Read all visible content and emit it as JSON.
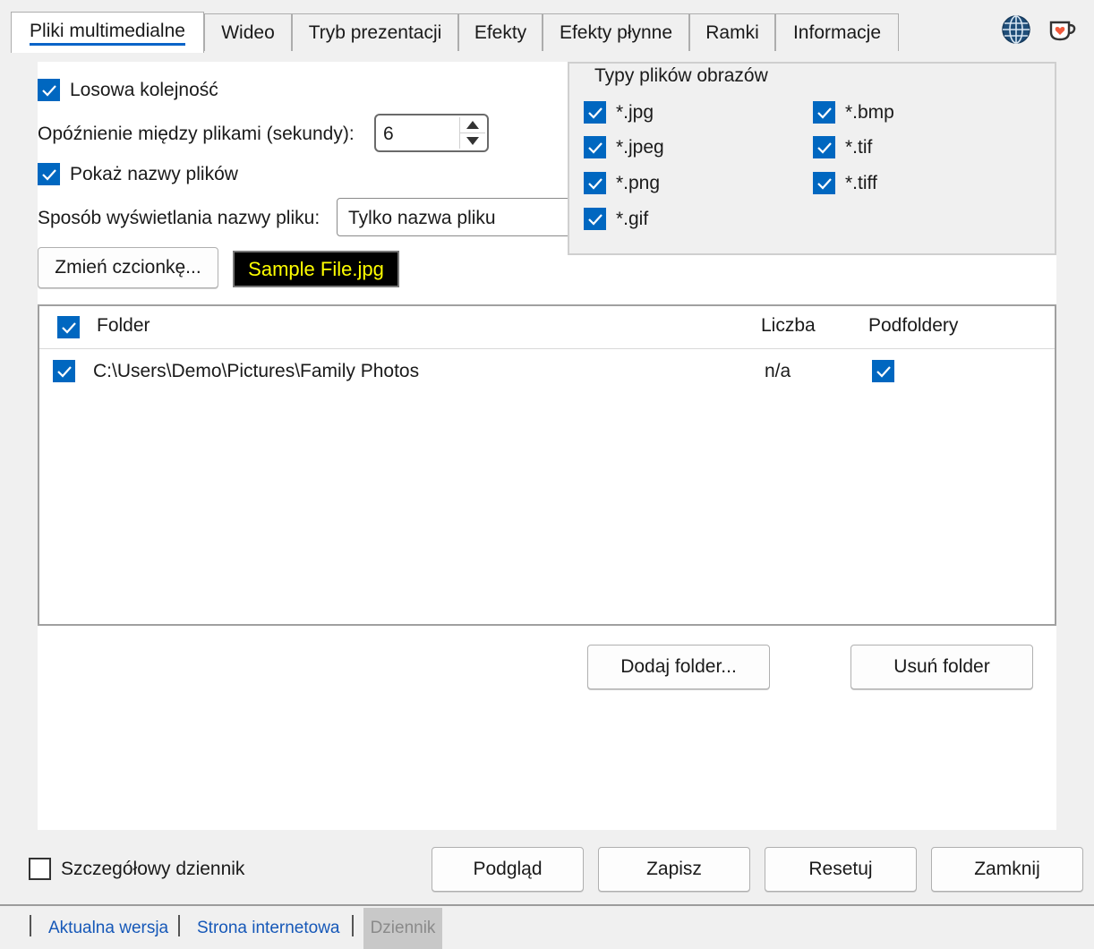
{
  "tabs": [
    {
      "label": "Pliki multimedialne",
      "active": true
    },
    {
      "label": "Wideo"
    },
    {
      "label": "Tryb prezentacji"
    },
    {
      "label": "Efekty"
    },
    {
      "label": "Efekty płynne"
    },
    {
      "label": "Ramki"
    },
    {
      "label": "Informacje"
    }
  ],
  "icons": {
    "language": "globe-icon",
    "donate": "coffee-heart-icon"
  },
  "settings": {
    "random_order_label": "Losowa kolejność",
    "random_order_checked": true,
    "delay_label": "Opóźnienie między plikami (sekundy):",
    "delay_value": "6",
    "show_names_label": "Pokaż nazwy plików",
    "show_names_checked": true,
    "name_display_label": "Sposób wyświetlania nazwy pliku:",
    "name_display_value": "Tylko nazwa pliku",
    "change_font_button": "Zmień czcionkę...",
    "font_sample": "Sample File.jpg",
    "font_sample_color": "#ffff00",
    "font_sample_bg": "#000000"
  },
  "image_types": {
    "title": "Typy plików obrazów",
    "items": [
      {
        "label": "*.jpg",
        "checked": true
      },
      {
        "label": "*.bmp",
        "checked": true
      },
      {
        "label": "*.jpeg",
        "checked": true
      },
      {
        "label": "*.tif",
        "checked": true
      },
      {
        "label": "*.png",
        "checked": true
      },
      {
        "label": "*.tiff",
        "checked": true
      },
      {
        "label": "*.gif",
        "checked": true
      }
    ]
  },
  "folders": {
    "columns": {
      "folder": "Folder",
      "count": "Liczba",
      "subfolders": "Podfoldery"
    },
    "select_all_checked": true,
    "rows": [
      {
        "checked": true,
        "path": "C:\\Users\\Demo\\Pictures\\Family Photos",
        "count": "n/a",
        "subfolders": true
      }
    ],
    "add_button": "Dodaj folder...",
    "remove_button": "Usuń folder"
  },
  "footer": {
    "verbose_log_label": "Szczegółowy dziennik",
    "verbose_log_checked": false,
    "preview_button": "Podgląd",
    "save_button": "Zapisz",
    "reset_button": "Resetuj",
    "close_button": "Zamknij"
  },
  "statusbar": {
    "current_version": "Aktualna wersja",
    "website": "Strona internetowa",
    "log": "Dziennik"
  },
  "colors": {
    "accent": "#0067c0",
    "link": "#1658b8",
    "tab_underline": "#0a64c8"
  }
}
